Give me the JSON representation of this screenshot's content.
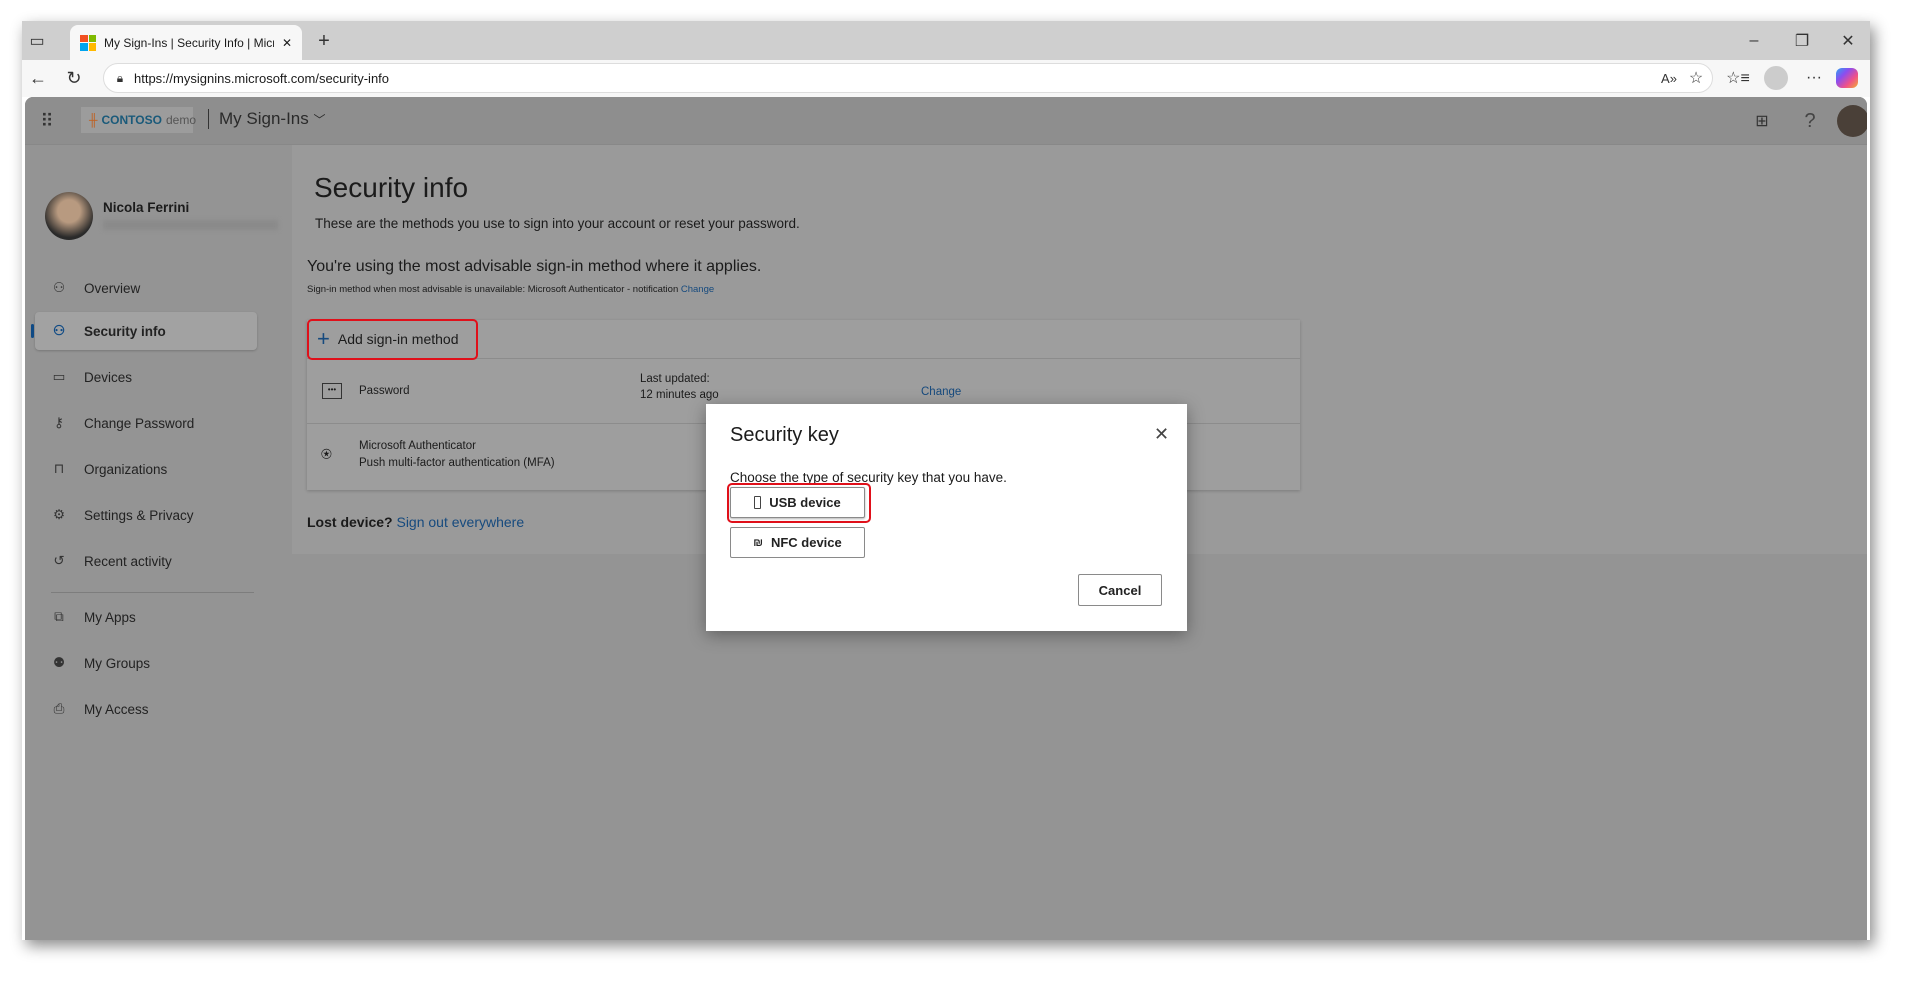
{
  "browser": {
    "tab_title": "My Sign-Ins | Security Info | Micro",
    "url": "https://mysignins.microsoft.com/security-info"
  },
  "header": {
    "logo_brand": "CONTOSO",
    "logo_suffix": "demo",
    "app_title": "My Sign-Ins"
  },
  "user": {
    "name": "Nicola Ferrini"
  },
  "sidebar": {
    "items": [
      {
        "label": "Overview",
        "icon": "person-icon"
      },
      {
        "label": "Security info",
        "icon": "person-key-icon",
        "selected": true
      },
      {
        "label": "Devices",
        "icon": "laptop-icon"
      },
      {
        "label": "Change Password",
        "icon": "key-icon"
      },
      {
        "label": "Organizations",
        "icon": "briefcase-icon"
      },
      {
        "label": "Settings & Privacy",
        "icon": "gear-icon"
      },
      {
        "label": "Recent activity",
        "icon": "history-icon"
      },
      {
        "label": "My Apps",
        "icon": "apps-icon"
      },
      {
        "label": "My Groups",
        "icon": "groups-icon"
      },
      {
        "label": "My Access",
        "icon": "access-icon"
      }
    ]
  },
  "main": {
    "title": "Security info",
    "subtitle": "These are the methods you use to sign into your account or reset your password.",
    "advisable": "You're using the most advisable sign-in method where it applies.",
    "fallback": "Sign-in method when most advisable is unavailable: Microsoft Authenticator - notification",
    "fallback_link": "Change",
    "add_method": "Add sign-in method",
    "methods": [
      {
        "name": "Password",
        "updated_label": "Last updated:",
        "updated_value": "12 minutes ago",
        "action": "Change"
      },
      {
        "name": "Microsoft Authenticator",
        "detail": "Push multi-factor authentication (MFA)"
      }
    ],
    "lost_device": "Lost device?",
    "sign_out_everywhere": "Sign out everywhere"
  },
  "dialog": {
    "title": "Security key",
    "prompt": "Choose the type of security key that you have.",
    "usb": "USB device",
    "nfc": "NFC device",
    "cancel": "Cancel"
  },
  "colors": {
    "highlight": "#e0101a",
    "link": "#0f6cbd"
  }
}
